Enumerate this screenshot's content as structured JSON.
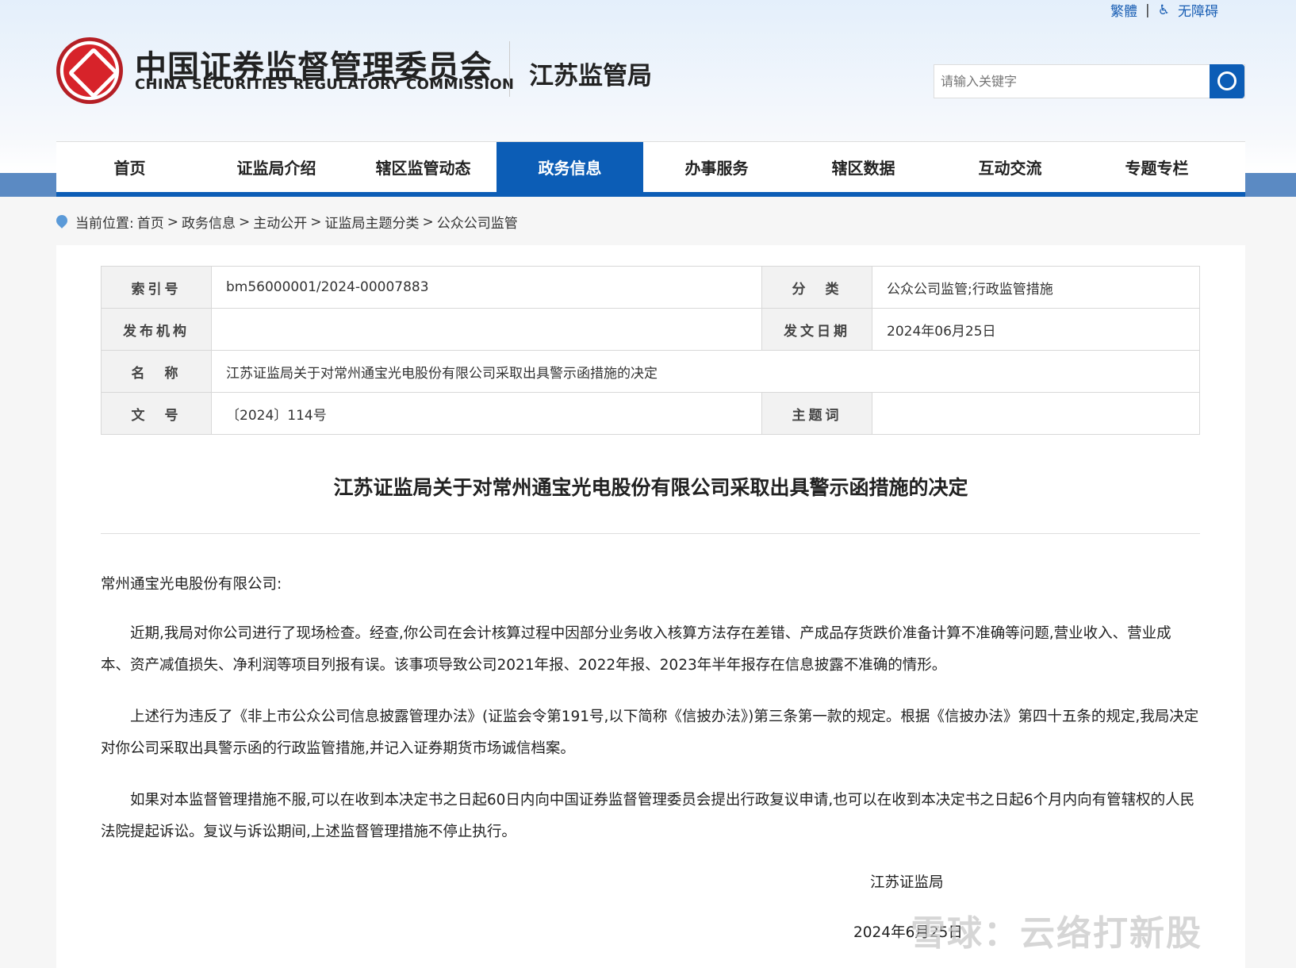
{
  "top_links": {
    "traditional": "繁體",
    "accessibility": "无障碍"
  },
  "header": {
    "org_cn": "中国证券监督管理委员会",
    "org_en": "CHINA SECURITIES REGULATORY COMMISSION",
    "bureau": "江苏监管局"
  },
  "search": {
    "placeholder": "请输入关键字"
  },
  "nav": [
    "首页",
    "证监局介绍",
    "辖区监管动态",
    "政务信息",
    "办事服务",
    "辖区数据",
    "互动交流",
    "专题专栏"
  ],
  "breadcrumb": {
    "label": "当前位置:",
    "items": [
      "首页",
      "政务信息",
      "主动公开",
      "证监局主题分类",
      "公众公司监管"
    ],
    "sep": ">"
  },
  "meta": {
    "index_label": "索引号",
    "index_value": "bm56000001/2024-00007883",
    "category_label": "分　类",
    "category_value": "公众公司监管;行政监管措施",
    "issuer_label": "发布机构",
    "issuer_value": "",
    "date_label": "发文日期",
    "date_value": "2024年06月25日",
    "name_label": "名　称",
    "name_value": "江苏证监局关于对常州通宝光电股份有限公司采取出具警示函措施的决定",
    "docno_label": "文　号",
    "docno_value": "〔2024〕114号",
    "keyword_label": "主题词",
    "keyword_value": ""
  },
  "document": {
    "title": "江苏证监局关于对常州通宝光电股份有限公司采取出具警示函措施的决定",
    "salutation": "常州通宝光电股份有限公司:",
    "paragraphs": [
      "近期,我局对你公司进行了现场检查。经查,你公司在会计核算过程中因部分业务收入核算方法存在差错、产成品存货跌价准备计算不准确等问题,营业收入、营业成本、资产减值损失、净利润等项目列报有误。该事项导致公司2021年报、2022年报、2023年半年报存在信息披露不准确的情形。",
      "上述行为违反了《非上市公众公司信息披露管理办法》(证监会令第191号,以下简称《信披办法》)第三条第一款的规定。根据《信披办法》第四十五条的规定,我局决定对你公司采取出具警示函的行政监管措施,并记入证券期货市场诚信档案。",
      "如果对本监督管理措施不服,可以在收到本决定书之日起60日内向中国证券监督管理委员会提出行政复议申请,也可以在收到本决定书之日起6个月内向有管辖权的人民法院提起诉讼。复议与诉讼期间,上述监督管理措施不停止执行。"
    ],
    "signature": "江苏证监局",
    "date": "2024年6月25日"
  },
  "watermark": "雪球：云络打新股"
}
